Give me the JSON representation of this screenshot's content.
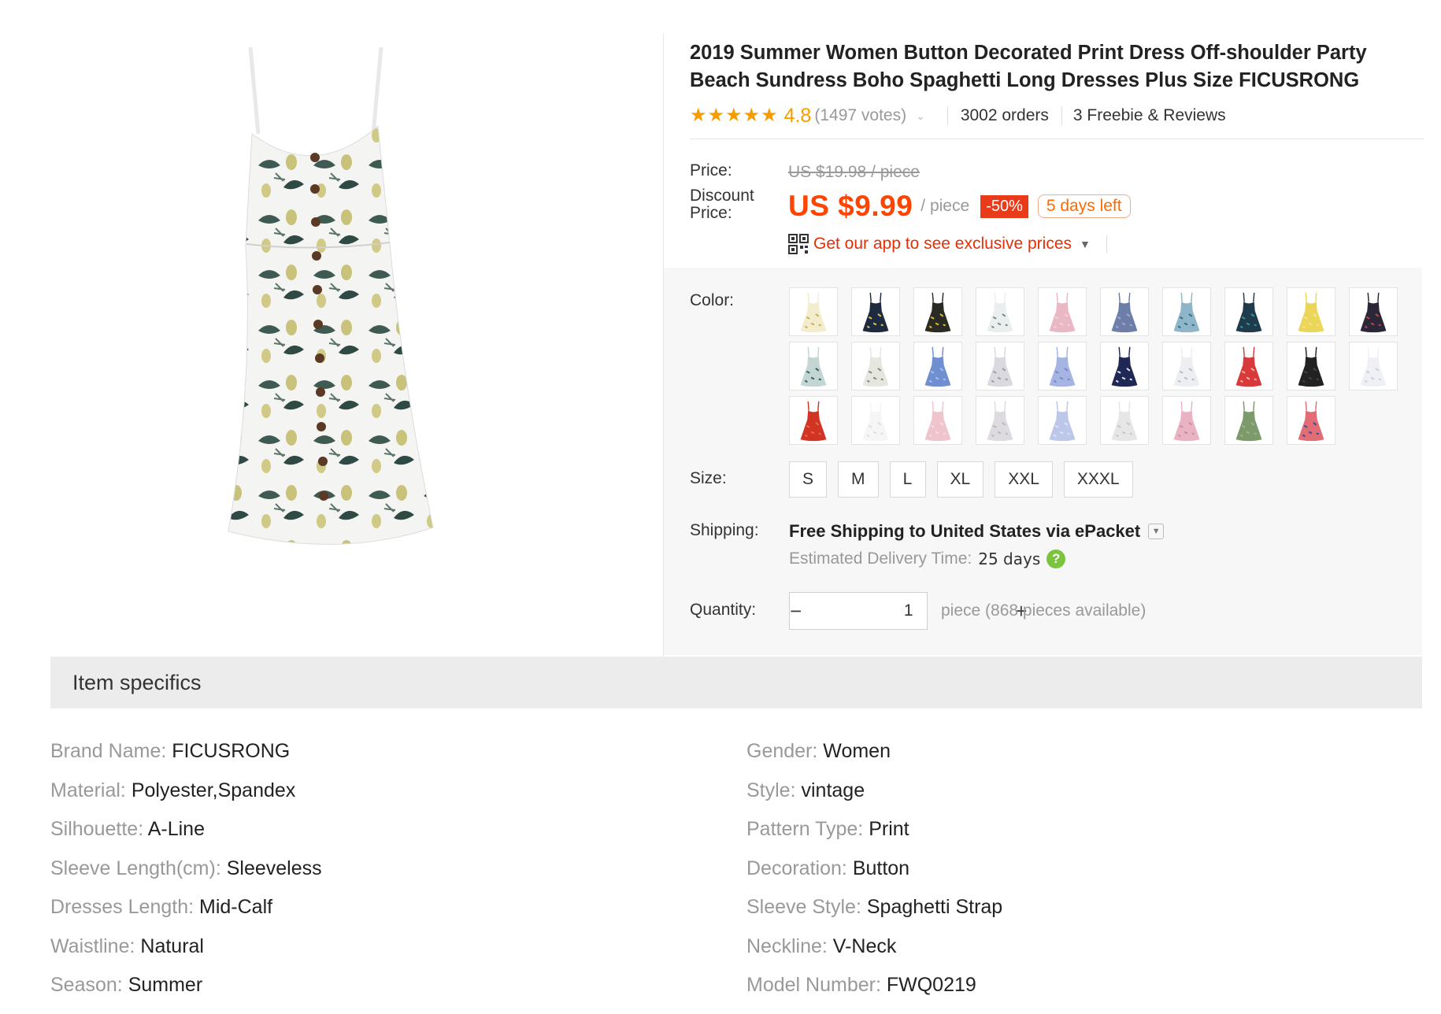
{
  "product": {
    "title": "2019 Summer Women Button Decorated Print Dress Off-shoulder Party Beach Sundress Boho Spaghetti Long Dresses Plus Size FICUSRONG",
    "main_image_icon": "floral-print-dress-image"
  },
  "rating": {
    "value": "4.8",
    "votes": "(1497 votes)",
    "stars": 4.8,
    "orders": "3002 orders",
    "reviews": "3 Freebie & Reviews"
  },
  "price": {
    "price_label": "Price:",
    "original": "US $19.98 / piece",
    "discount_label_1": "Discount",
    "discount_label_2": "Price:",
    "discount": "US $9.99",
    "per_piece": "/ piece",
    "off_badge": "-50%",
    "days_badge": "5 days left",
    "app_link": "Get our app to see exclusive prices"
  },
  "color": {
    "label": "Color:",
    "swatches": [
      {
        "bg": "#f3eccd",
        "accent": "#c9b05a"
      },
      {
        "bg": "#1d2a40",
        "accent": "#e6c648"
      },
      {
        "bg": "#2b2b25",
        "accent": "#e3b93a"
      },
      {
        "bg": "#e9eeee",
        "accent": "#7a8a86"
      },
      {
        "bg": "#eab8c4",
        "accent": "#f2d4db"
      },
      {
        "bg": "#6d7ea8",
        "accent": "#9eaccc"
      },
      {
        "bg": "#8fb5c8",
        "accent": "#2f6e86"
      },
      {
        "bg": "#1f3b4c",
        "accent": "#2f9a8c"
      },
      {
        "bg": "#ecd65a",
        "accent": "#f4e58e"
      },
      {
        "bg": "#2c2639",
        "accent": "#c2463c"
      },
      {
        "bg": "#c3d6d4",
        "accent": "#355e5a"
      },
      {
        "bg": "#e4e6df",
        "accent": "#7f8f72"
      },
      {
        "bg": "#6f8fd0",
        "accent": "#a9c0ee"
      },
      {
        "bg": "#d9d9df",
        "accent": "#9c9cab"
      },
      {
        "bg": "#a5b4e2",
        "accent": "#7386c8"
      },
      {
        "bg": "#1f2854",
        "accent": "#e3e6f0"
      },
      {
        "bg": "#eceef2",
        "accent": "#b7bccb"
      },
      {
        "bg": "#d8393b",
        "accent": "#f1b6a5"
      },
      {
        "bg": "#222222",
        "accent": "#444444"
      },
      {
        "bg": "#eef0f6",
        "accent": "#c8cfe2"
      },
      {
        "bg": "#d23424",
        "accent": "#e86a54"
      },
      {
        "bg": "#f6f6f6",
        "accent": "#dddddd"
      },
      {
        "bg": "#efc4cd",
        "accent": "#f7dde3"
      },
      {
        "bg": "#dedbe0",
        "accent": "#b9b4be"
      },
      {
        "bg": "#bcc7ea",
        "accent": "#dde3f5"
      },
      {
        "bg": "#e6e6e6",
        "accent": "#c6c6c6"
      },
      {
        "bg": "#e9b3c4",
        "accent": "#cf8aa2"
      },
      {
        "bg": "#7d9a6a",
        "accent": "#9db58b"
      },
      {
        "bg": "#e26d75",
        "accent": "#2e4f9f"
      }
    ]
  },
  "size": {
    "label": "Size:",
    "options": [
      "S",
      "M",
      "L",
      "XL",
      "XXL",
      "XXXL"
    ]
  },
  "shipping": {
    "label": "Shipping:",
    "method": "Free Shipping to United States via ePacket",
    "time_label": "Estimated Delivery Time:",
    "time_value": "25 days"
  },
  "quantity": {
    "label": "Quantity:",
    "value": "1",
    "minus": "−",
    "plus": "+",
    "note": "piece (868 pieces available)"
  },
  "specs": {
    "title": "Item specifics",
    "left": [
      {
        "key": "Brand Name:",
        "value": "FICUSRONG"
      },
      {
        "key": "Material:",
        "value": "Polyester,Spandex"
      },
      {
        "key": "Silhouette:",
        "value": "A-Line"
      },
      {
        "key": "Sleeve Length(cm):",
        "value": "Sleeveless"
      },
      {
        "key": "Dresses Length:",
        "value": "Mid-Calf"
      },
      {
        "key": "Waistline:",
        "value": "Natural"
      },
      {
        "key": "Season:",
        "value": "Summer"
      }
    ],
    "right": [
      {
        "key": "Gender:",
        "value": "Women"
      },
      {
        "key": "Style:",
        "value": "vintage"
      },
      {
        "key": "Pattern Type:",
        "value": "Print"
      },
      {
        "key": "Decoration:",
        "value": "Button"
      },
      {
        "key": "Sleeve Style:",
        "value": "Spaghetti Strap"
      },
      {
        "key": "Neckline:",
        "value": "V-Neck"
      },
      {
        "key": "Model Number:",
        "value": "FWQ0219"
      }
    ]
  },
  "colors": {
    "accent_orange": "#ff4400",
    "star": "#f79c00",
    "link_red": "#e62e04",
    "help_green": "#7bc43d"
  }
}
